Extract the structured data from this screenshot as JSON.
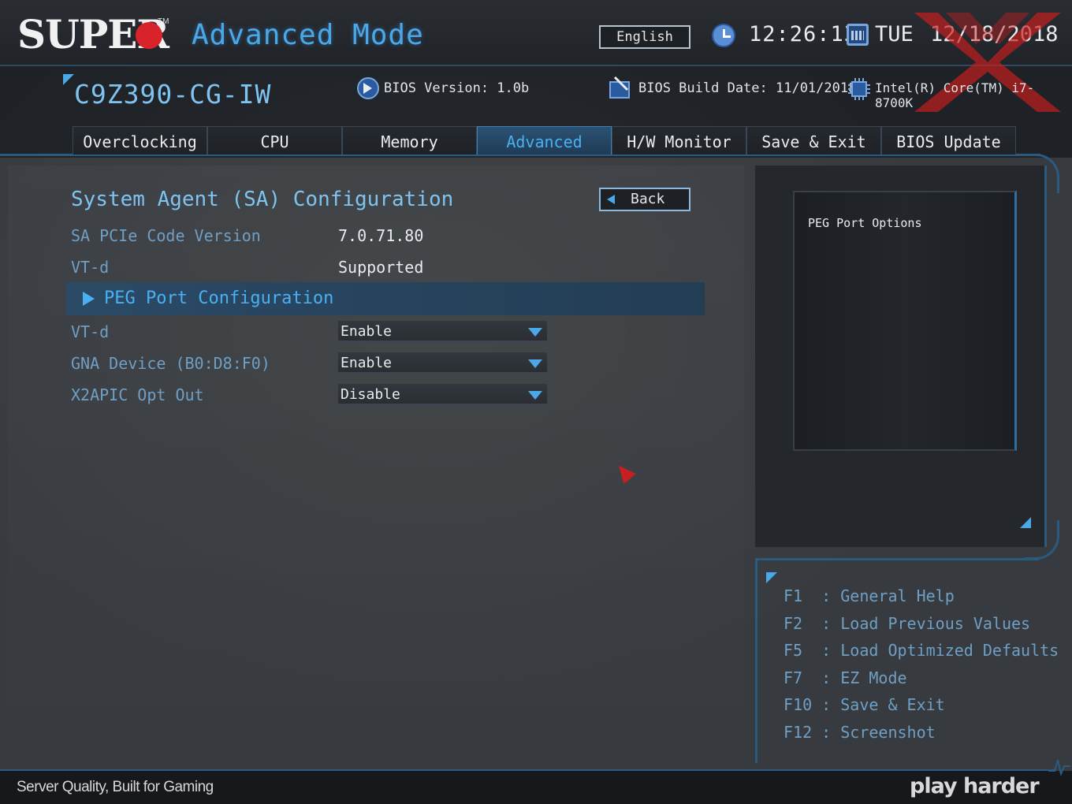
{
  "header": {
    "logo_text": "SUPER",
    "trademark": "TM",
    "mode_title": "Advanced Mode",
    "language": "English",
    "time": "12:26:13",
    "day": "TUE",
    "date": "12/18/2018"
  },
  "info": {
    "model": "C9Z390-CG-IW",
    "bios_version": "BIOS Version: 1.0b",
    "bios_build_date": "BIOS Build Date: 11/01/2018",
    "cpu": "Intel(R) Core(TM) i7-8700K"
  },
  "tabs": [
    {
      "label": "Overclocking"
    },
    {
      "label": "CPU"
    },
    {
      "label": "Memory"
    },
    {
      "label": "Advanced",
      "active": true
    },
    {
      "label": "H/W Monitor"
    },
    {
      "label": "Save & Exit"
    },
    {
      "label": "BIOS Update"
    }
  ],
  "main": {
    "section_title": "System Agent (SA) Configuration",
    "back_label": "Back",
    "info_rows": [
      {
        "label": "SA PCIe Code Version",
        "value": "7.0.71.80"
      },
      {
        "label": "VT-d",
        "value": "Supported"
      }
    ],
    "submenu": {
      "label": "PEG Port Configuration"
    },
    "settings": [
      {
        "label": "VT-d",
        "value": "Enable"
      },
      {
        "label": "GNA Device (B0:D8:F0)",
        "value": "Enable"
      },
      {
        "label": "X2APIC Opt Out",
        "value": "Disable"
      }
    ]
  },
  "help": {
    "text": "PEG Port Options"
  },
  "keys": [
    {
      "key": "F1 ",
      "desc": ": General Help"
    },
    {
      "key": "F2 ",
      "desc": ": Load Previous Values"
    },
    {
      "key": "F5 ",
      "desc": ": Load Optimized Defaults"
    },
    {
      "key": "F7 ",
      "desc": ": EZ Mode"
    },
    {
      "key": "F10",
      "desc": ": Save & Exit"
    },
    {
      "key": "F12",
      "desc": ": Screenshot"
    }
  ],
  "footer": {
    "slogan": "Server Quality, Built for Gaming",
    "brand": "play harder"
  },
  "colors": {
    "accent": "#4aa8e8",
    "label": "#6f9fc4",
    "highlight_row": "#2b4a66",
    "logo_red": "#d9232a"
  }
}
